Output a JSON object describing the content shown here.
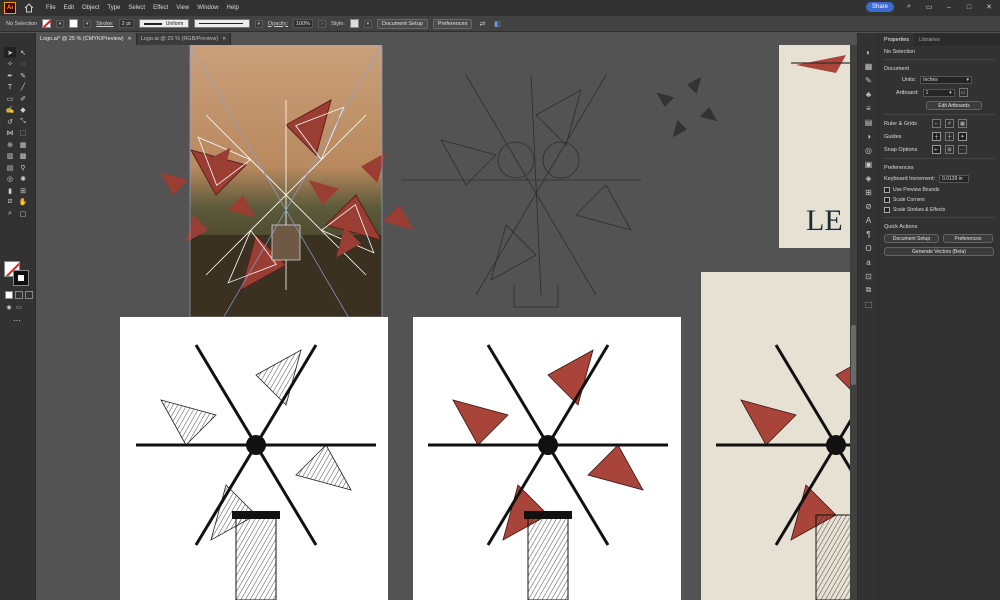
{
  "app": {
    "logo": "Ai",
    "menu": [
      "File",
      "Edit",
      "Object",
      "Type",
      "Select",
      "Effect",
      "View",
      "Window",
      "Help"
    ],
    "share_label": "Share"
  },
  "controlbar": {
    "selection": "No Selection",
    "stroke_label": "Stroke:",
    "stroke_weight": "2 pt",
    "stroke_profile": "Uniform",
    "opacity_label": "Opacity:",
    "opacity_value": "100%",
    "style_label": "Style:",
    "doc_setup": "Document Setup",
    "preferences": "Preferences"
  },
  "tabs": [
    {
      "label": "Logo.ai* @ 25 % (CMYK/Preview)"
    },
    {
      "label": "Logo.ai @ 25 % (RGB/Preview)"
    }
  ],
  "properties": {
    "tab_properties": "Properties",
    "tab_libraries": "Libraries",
    "no_selection": "No Selection",
    "document": "Document",
    "units_label": "Units:",
    "units_value": "Inches",
    "artboard_label": "Artboard:",
    "artboard_value": "1",
    "edit_artboards": "Edit Artboards",
    "ruler_grids": "Ruler & Grids",
    "guides": "Guides",
    "snap_options": "Snap Options",
    "preferences": "Preferences",
    "keyboard_increment_label": "Keyboard Increment:",
    "keyboard_increment_value": "0.0139 in",
    "use_preview_bounds": "Use Preview Bounds",
    "scale_corners": "Scale Corners",
    "scale_strokes": "Scale Strokes & Effects",
    "quick_actions": "Quick Actions",
    "qa_doc_setup": "Document Setup",
    "qa_preferences": "Preferences",
    "generate_vectors": "Generate Vectors (Beta)"
  },
  "canvas": {
    "partial_text": "LE"
  },
  "colors": {
    "sail_red": "#a8443a",
    "cream": "#e6e1d3"
  }
}
